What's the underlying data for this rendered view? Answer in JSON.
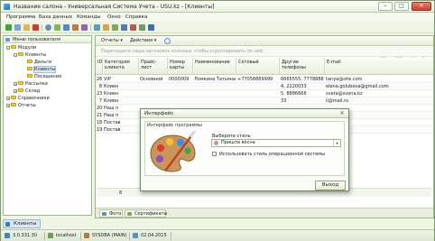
{
  "window": {
    "title": "Название салона - Универсальная Система Учета - USU.kz - [Клиенты]",
    "minimize": "–",
    "maximize": "□",
    "close": "✕"
  },
  "menu": [
    "Программа",
    "База данных",
    "Команды",
    "Окно",
    "Справка"
  ],
  "left_panel": {
    "header": "Меню пользователя",
    "tree": [
      {
        "label": "Модули",
        "level": 0,
        "expander": "−"
      },
      {
        "label": "Клиенты",
        "level": 1,
        "expander": "−"
      },
      {
        "label": "Деньги",
        "level": 2,
        "expander": ""
      },
      {
        "label": "Клиенты",
        "level": 2,
        "expander": "",
        "selected": true
      },
      {
        "label": "Посещения",
        "level": 2,
        "expander": ""
      },
      {
        "label": "Рассылка",
        "level": 1,
        "expander": "+"
      },
      {
        "label": "Склад",
        "level": 1,
        "expander": "+"
      },
      {
        "label": "Справочники",
        "level": 0,
        "expander": "+"
      },
      {
        "label": "Отчеты",
        "level": 0,
        "expander": "+"
      }
    ]
  },
  "main": {
    "reports_btn": "Отчеты",
    "actions_btn": "Действия",
    "group_hint": "Перетащите сюда заголовок колонки, чтобы сгруппировать по ней",
    "columns": [
      "ID",
      "Категория клиента",
      "Прайс-лист",
      "Номер карты",
      "Наименование",
      "Сотовый",
      "Другие телефоны",
      "E-mail"
    ],
    "rows": [
      [
        "26",
        "VIP",
        "Основной",
        "0000009",
        "Ломкина Татьяна",
        "+77058889999",
        "6665555, 7778888",
        "tanya@site.com"
      ],
      [
        "8",
        "Клиен",
        "",
        "",
        "",
        "",
        "4, 2220033",
        "elena.golubeva@gmail.com"
      ],
      [
        "23",
        "Клиен",
        "",
        "",
        "",
        "",
        "5, 8886666",
        "sveta@svena.kz"
      ],
      [
        "7",
        "Клиен",
        "",
        "",
        "",
        "",
        "33",
        "ii@mail.ru"
      ],
      [
        "20",
        "Наш п",
        "",
        "",
        "",
        "",
        "",
        ""
      ],
      [
        "21",
        "Наш п",
        "",
        "",
        "",
        "",
        "",
        ""
      ],
      [
        "18",
        "Постав",
        "",
        "",
        "",
        "",
        "",
        ""
      ],
      [
        "19",
        "Постав",
        "",
        "",
        "",
        "",
        "",
        ""
      ]
    ],
    "count": "8",
    "tab_photo": "Фото",
    "tab_certs": "Сертификаты"
  },
  "dialog": {
    "title": "Интерфейс",
    "close": "✕",
    "group_label": "Интерфейс программы",
    "style_label": "Выберите стиль",
    "style_value": "Пришла весна",
    "checkbox_label": "Использовать стиль операционной системы",
    "exit_button": "Выход"
  },
  "taskbar": {
    "tab": "Клиенты"
  },
  "status": {
    "version": "3.0.331.30",
    "host": "localhost",
    "db": "SYSDBA (MAIN)",
    "date": "02.04.2015"
  },
  "colors": {
    "accent_green": "#7f9a67",
    "selection_blue": "#dce8f7",
    "close_red": "#c9412c"
  }
}
